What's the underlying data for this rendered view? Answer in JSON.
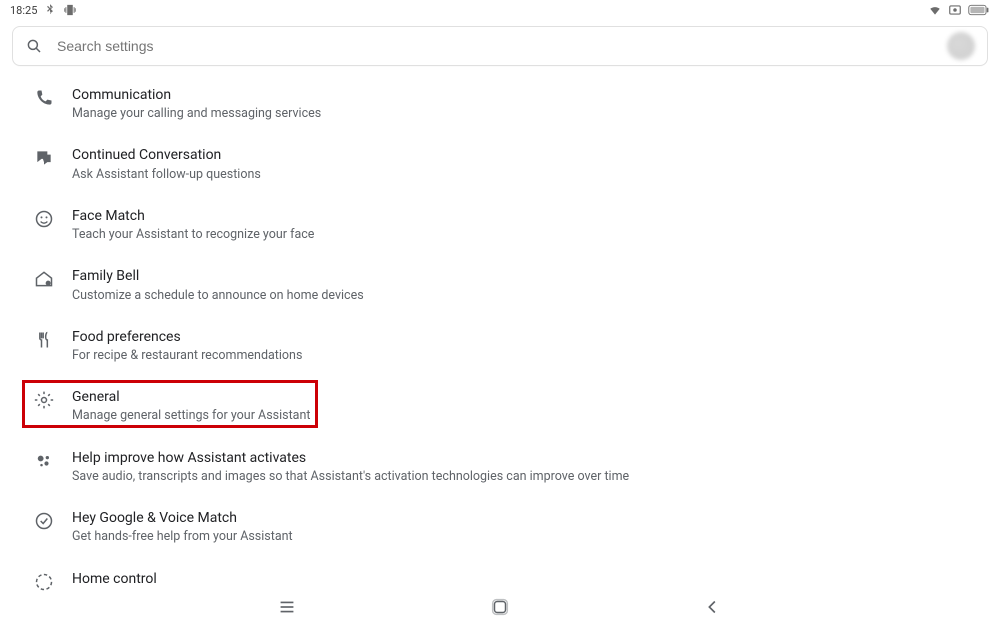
{
  "status": {
    "time": "18:25"
  },
  "search": {
    "placeholder": "Search settings"
  },
  "items": [
    {
      "title": "Communication",
      "sub": "Manage your calling and messaging services",
      "icon": "phone",
      "highlight": false
    },
    {
      "title": "Continued Conversation",
      "sub": "Ask Assistant follow-up questions",
      "icon": "chat",
      "highlight": false
    },
    {
      "title": "Face Match",
      "sub": "Teach your Assistant to recognize your face",
      "icon": "face",
      "highlight": false
    },
    {
      "title": "Family Bell",
      "sub": "Customize a schedule to announce on home devices",
      "icon": "home-bell",
      "highlight": false
    },
    {
      "title": "Food preferences",
      "sub": "For recipe & restaurant recommendations",
      "icon": "restaurant",
      "highlight": false
    },
    {
      "title": "General",
      "sub": "Manage general settings for your Assistant",
      "icon": "gear",
      "highlight": true
    },
    {
      "title": "Help improve how Assistant activates",
      "sub": "Save audio, transcripts and images so that Assistant's activation technologies can improve over time",
      "icon": "assistant",
      "highlight": false
    },
    {
      "title": "Hey Google & Voice Match",
      "sub": "Get hands-free help from your Assistant",
      "icon": "check-circle",
      "highlight": false
    },
    {
      "title": "Home control",
      "sub": "",
      "icon": "home-control",
      "highlight": false
    }
  ]
}
